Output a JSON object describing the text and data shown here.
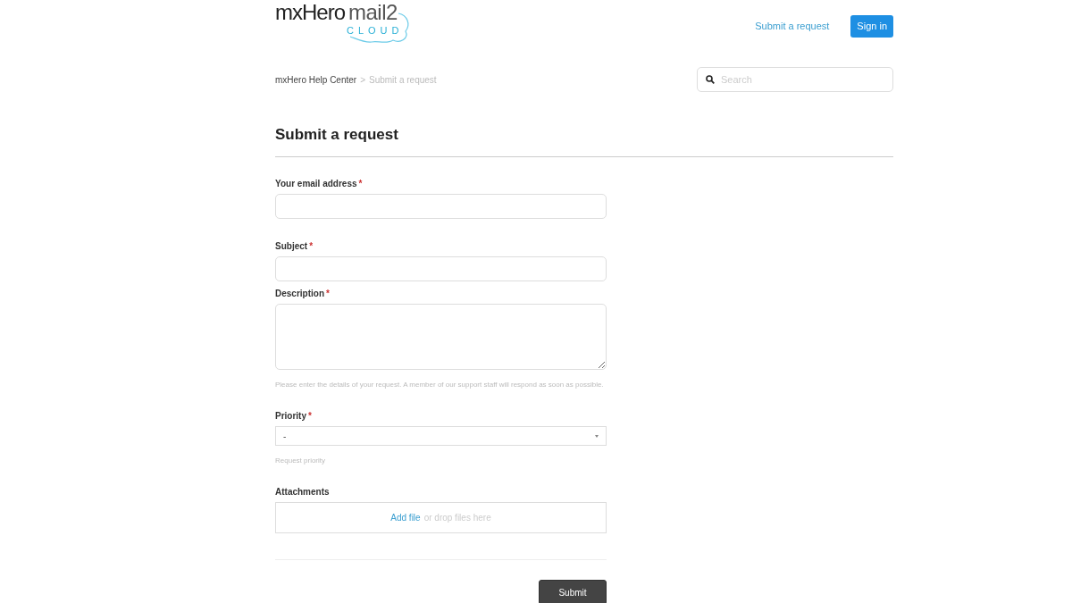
{
  "header": {
    "logo": {
      "brand": "mxHero",
      "product": "mail2",
      "tagline": "CLOUD"
    },
    "nav_link": "Submit a request",
    "sign_in": "Sign in"
  },
  "breadcrumbs": [
    {
      "label": "mxHero Help Center",
      "current": false
    },
    {
      "label": "Submit a request",
      "current": true
    }
  ],
  "breadcrumb_separator": ">",
  "search": {
    "placeholder": "Search"
  },
  "page_title": "Submit a request",
  "fields": [
    {
      "kind": "text",
      "label": "Your email address",
      "asterisk": "*"
    },
    {
      "kind": "text",
      "label": "Subject",
      "asterisk": "*"
    },
    {
      "kind": "textarea",
      "label": "Description",
      "asterisk": "*",
      "hint": "Please enter the details of your request. A member of our support staff will respond as soon as possible."
    },
    {
      "kind": "select",
      "label": "Priority",
      "asterisk": "*",
      "value": "-",
      "hint": "Request priority"
    },
    {
      "kind": "attachments",
      "label": "Attachments",
      "link": "Add file",
      "drop_text": "or drop files here"
    }
  ],
  "submit": "Submit"
}
